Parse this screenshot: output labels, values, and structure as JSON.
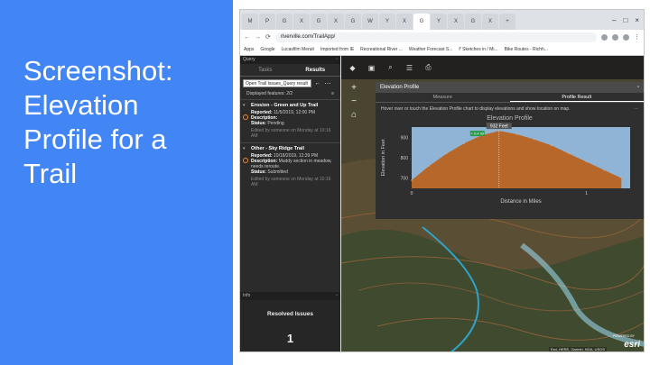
{
  "slide": {
    "title": "Screenshot:\nElevation\nProfile for a\nTrail"
  },
  "browser": {
    "url": "riverville.com/TrailApp/",
    "bookmarks": [
      "Apps",
      "Google",
      "Lucasfilm Meruit",
      "Imported from IE",
      "Recreational River ...",
      "Weather Forecast S...",
      "f' Sketches in / Mi...",
      "Bike Routes - Richh..."
    ],
    "tab_icons": [
      "M",
      "P",
      "G",
      "X",
      "G",
      "X",
      "G",
      "W",
      "Y",
      "X",
      "G",
      "Y",
      "X",
      "G",
      "X",
      "+"
    ],
    "controls": [
      "–",
      "□",
      "×"
    ]
  },
  "sidebar": {
    "header": "Query",
    "tabs": [
      "Tasks",
      "Results"
    ],
    "select_value": "Open Trail Issues_Query result",
    "count_text": "Displayed features: 2/2",
    "features": [
      {
        "title": "Erosion - Green and Up Trail",
        "reported_label": "Reported:",
        "reported_value": "11/5/2019, 12:00 PM",
        "description_label": "Description:",
        "description_value": "",
        "status_label": "Status:",
        "status_value": "Pending",
        "meta": "Edited by someone on Monday at 10:16 AM"
      },
      {
        "title": "Other - Sky Ridge Trail",
        "reported_label": "Reported:",
        "reported_value": "10/18/2019, 12:39 PM",
        "description_label": "Description:",
        "description_value": "Muddy section in meadow, needs reroute.",
        "status_label": "Status:",
        "status_value": "Submitted",
        "meta": "Edited by someone on Monday at 10:16 AM"
      }
    ]
  },
  "info_panel": {
    "header": "Info",
    "title": "Resolved Issues",
    "count": "1"
  },
  "elevation": {
    "header": "Elevation Profile",
    "tabs": [
      "Measure",
      "Profile Result"
    ],
    "hint": "Hover over or touch the Elevation Profile chart to display elevations and show location on map.",
    "chart_title": "Elevation Profile",
    "peak_label": "932 Feet",
    "marker_label": "+ 0.4 mi",
    "xlabel": "Distance in Miles",
    "ylabel": "Elevation in Feet",
    "yticks": [
      "900",
      "800",
      "700"
    ],
    "xticks": [
      "0",
      "1"
    ]
  },
  "map": {
    "credit": "Esri, HERE, Garmin, NGA, USGS",
    "esri_small": "POWERED BY",
    "esri": "esri"
  },
  "colors": {
    "slide_bg": "#4285f4",
    "profile_fill": "#b8672a",
    "profile_sky": "#8fb4d6",
    "river": "#2fa3c9"
  },
  "chart_data": {
    "type": "area",
    "title": "Elevation Profile",
    "xlabel": "Distance in Miles",
    "ylabel": "Elevation in Feet",
    "x": [
      0,
      0.1,
      0.2,
      0.3,
      0.4,
      0.5,
      0.6,
      0.7,
      0.8,
      0.9,
      1.0,
      1.1,
      1.2
    ],
    "y": [
      690,
      760,
      820,
      870,
      910,
      932,
      915,
      890,
      860,
      820,
      780,
      740,
      700
    ],
    "ylim": [
      650,
      950
    ],
    "xlim": [
      0,
      1.25
    ]
  }
}
